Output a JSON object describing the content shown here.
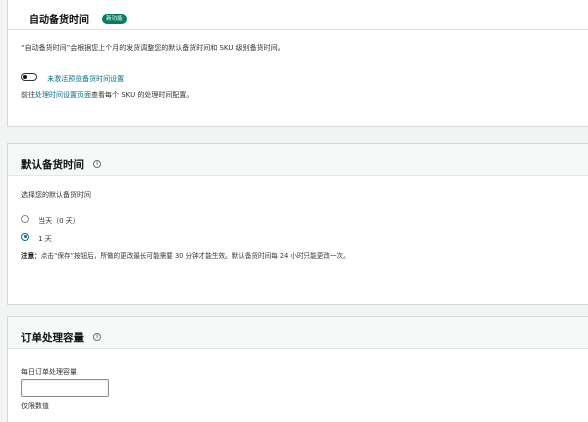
{
  "auto_handling": {
    "title": "自动备货时间",
    "badge": "新功能",
    "description": "“自动备货时间”会根据您上个月的发货调整您的默认备货时间和 SKU 级别备货时间。",
    "toggle_label": "未激活预览备货时间设置",
    "link_prefix": "前往",
    "link_text": "处理时间设置页面",
    "link_suffix": "查看每个 SKU 的处理时间配置。"
  },
  "default_handling": {
    "title": "默认备货时间",
    "prompt": "选择您的默认备货时间",
    "options": [
      {
        "label": "当天（0 天）",
        "checked": false
      },
      {
        "label": "1 天",
        "checked": true
      }
    ],
    "note_bold": "注意：",
    "note_text": "点击“保存”按钮后，所做的更改最长可能需要 30 分钟才能生效。默认备货时间每 24 小时只能更改一次。"
  },
  "order_capacity": {
    "title": "订单处理容量",
    "field_label": "每日订单处理容量",
    "input_value": "",
    "hint": "仅限数值"
  }
}
